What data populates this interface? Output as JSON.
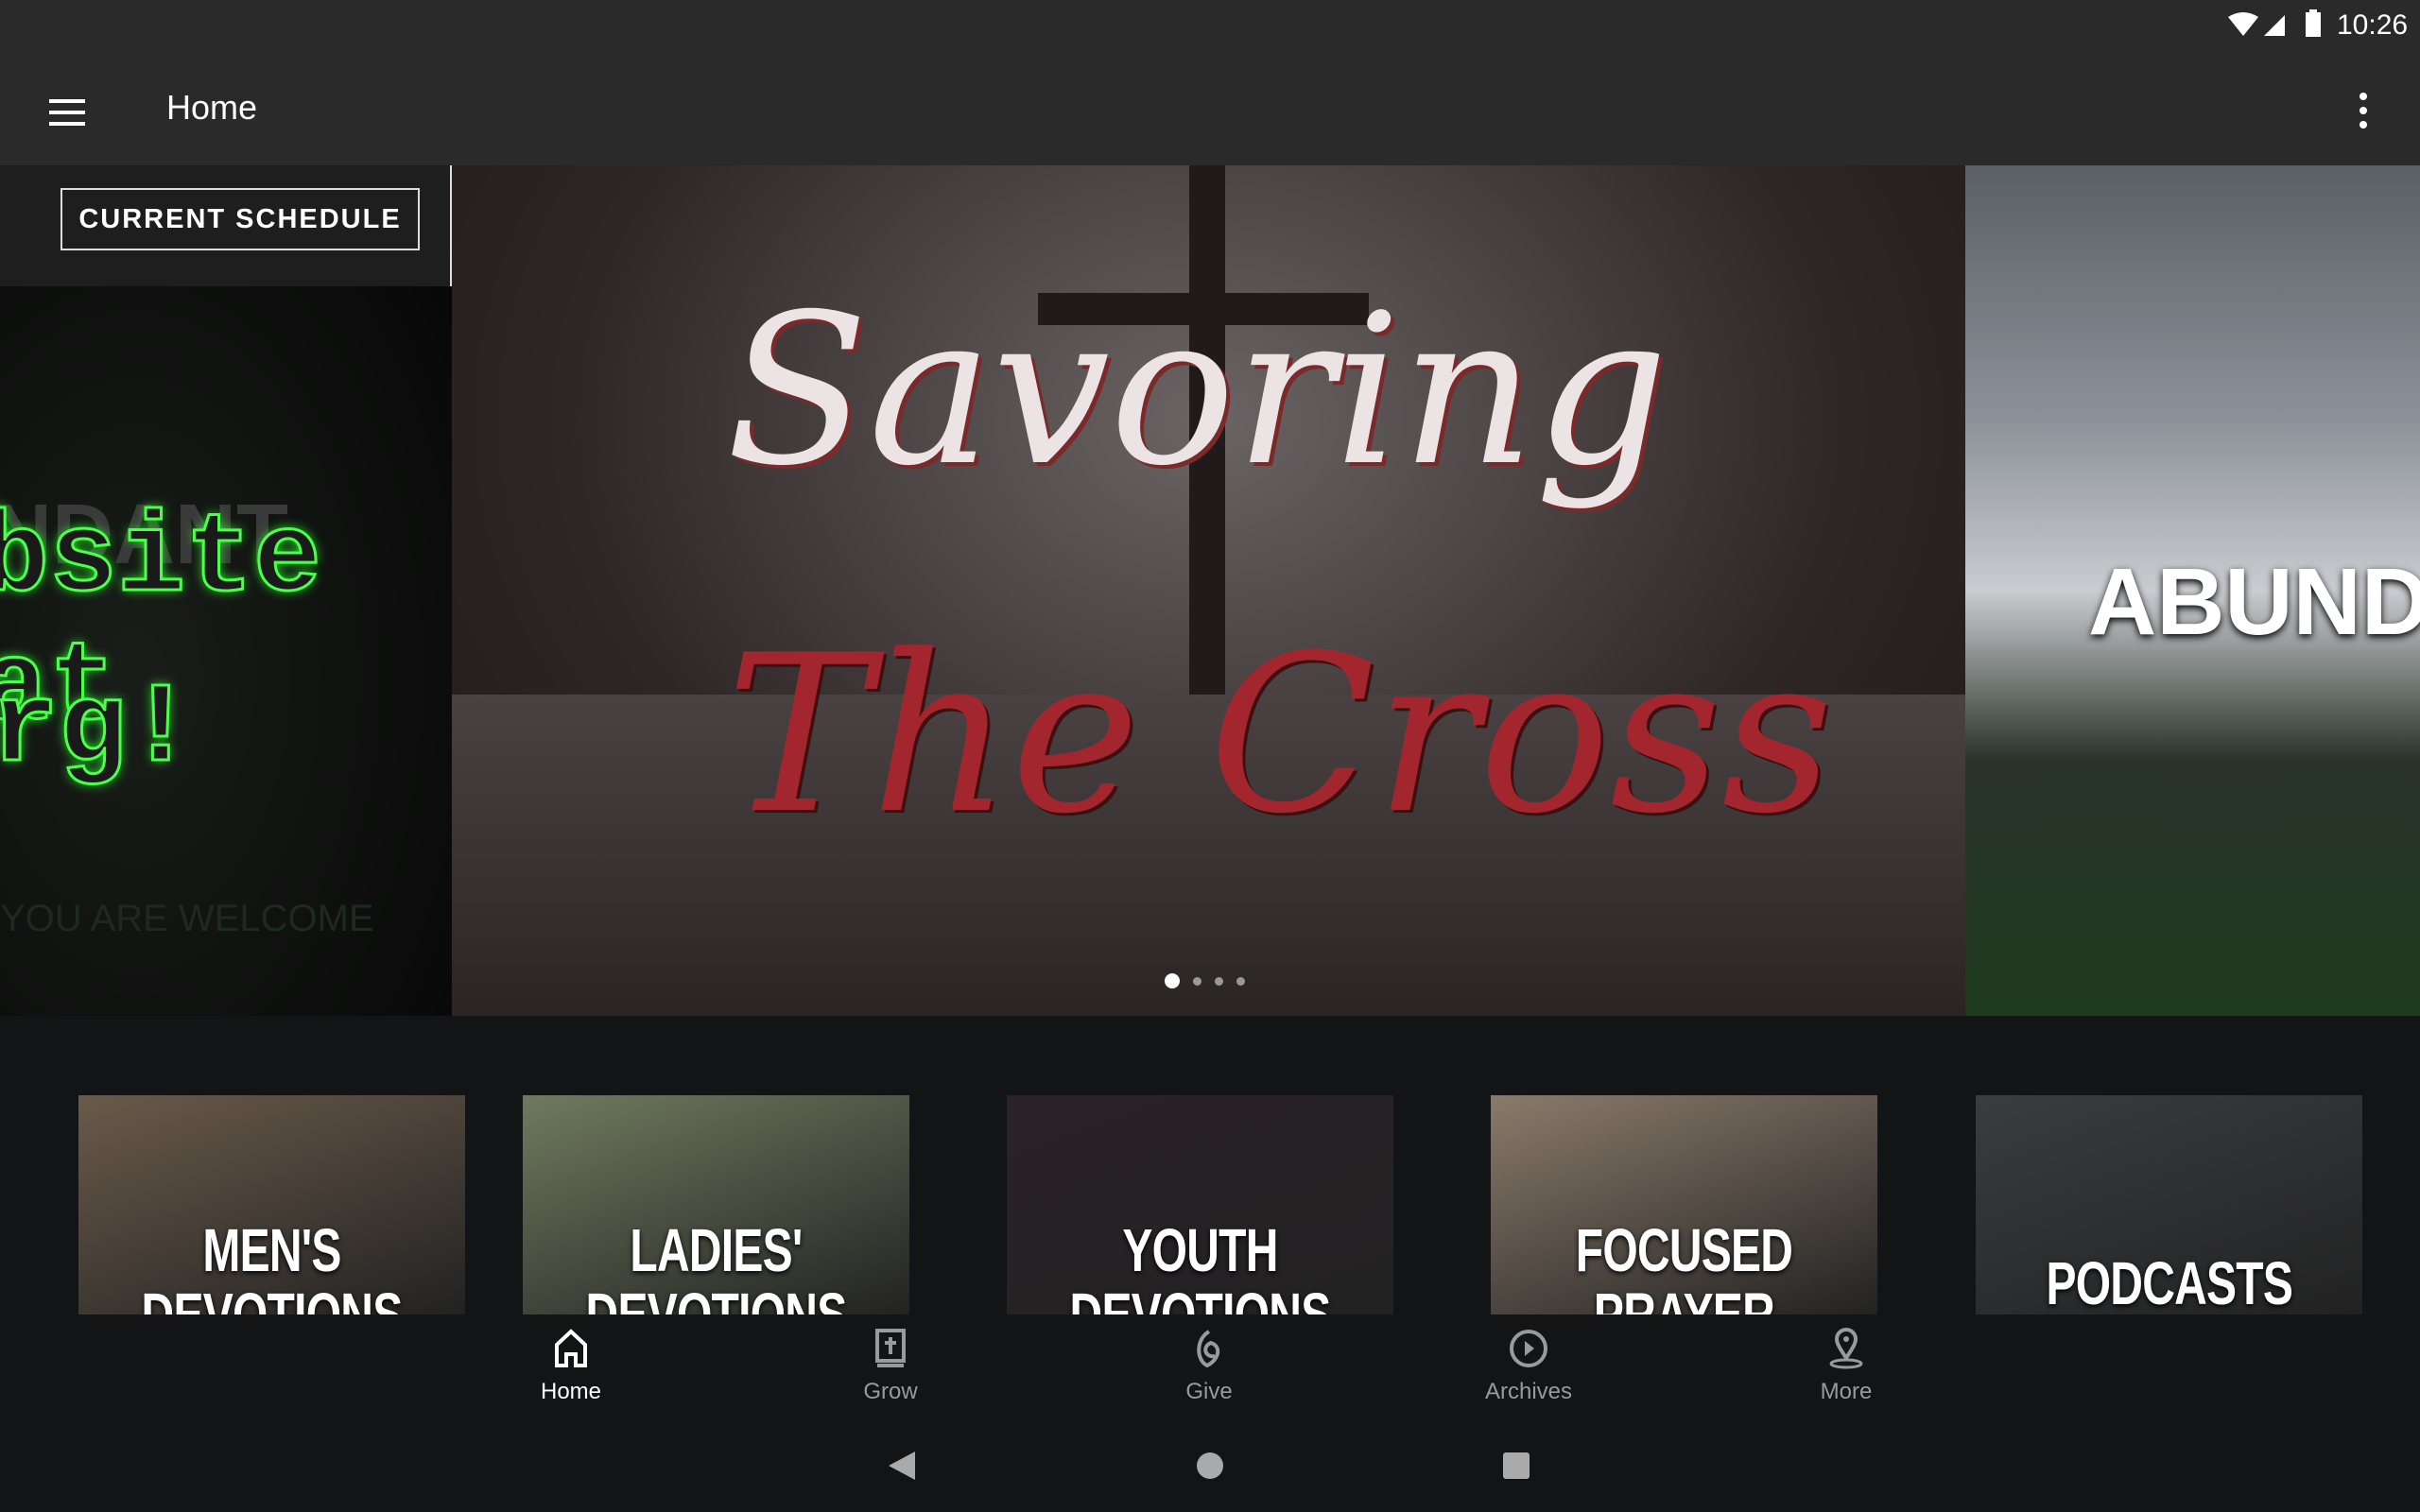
{
  "status": {
    "time": "10:26",
    "icons": [
      "wifi-icon",
      "signal-icon",
      "battery-icon"
    ]
  },
  "appbar": {
    "title": "Home",
    "menu_icon": "hamburger-icon",
    "overflow_icon": "more-vert-icon"
  },
  "hero": {
    "schedule_button": "CURRENT SCHEDULE",
    "left_slide": {
      "line1": "bsite at",
      "line2": "rg!",
      "ghost": "NDANT",
      "footer": "YOU ARE WELCOME"
    },
    "center_slide": {
      "title_line1": "Savoring",
      "title_line2": "The Cross"
    },
    "right_slide": {
      "text": "ABUND"
    },
    "page_count": 4,
    "active_page": 1
  },
  "tiles": [
    {
      "label": "MEN'S DEVOTIONS",
      "color": "#6a5a4a"
    },
    {
      "label": "LADIES' DEVOTIONS",
      "color": "#6f7a5e"
    },
    {
      "label": "YOUTH DEVOTIONS",
      "color": "#2a2228"
    },
    {
      "label": "FOCUSED PRAYER",
      "color": "#8a7a6a"
    },
    {
      "label": "PODCASTS",
      "color": "#3a3c40"
    }
  ],
  "bottom_nav": [
    {
      "label": "Home",
      "icon": "home-icon",
      "active": true
    },
    {
      "label": "Grow",
      "icon": "bible-icon"
    },
    {
      "label": "Give",
      "icon": "give-icon"
    },
    {
      "label": "Archives",
      "icon": "play-circle-icon"
    },
    {
      "label": "More",
      "icon": "location-pin-icon"
    }
  ],
  "system_nav": [
    "back-icon",
    "home-circle-icon",
    "recents-icon"
  ]
}
